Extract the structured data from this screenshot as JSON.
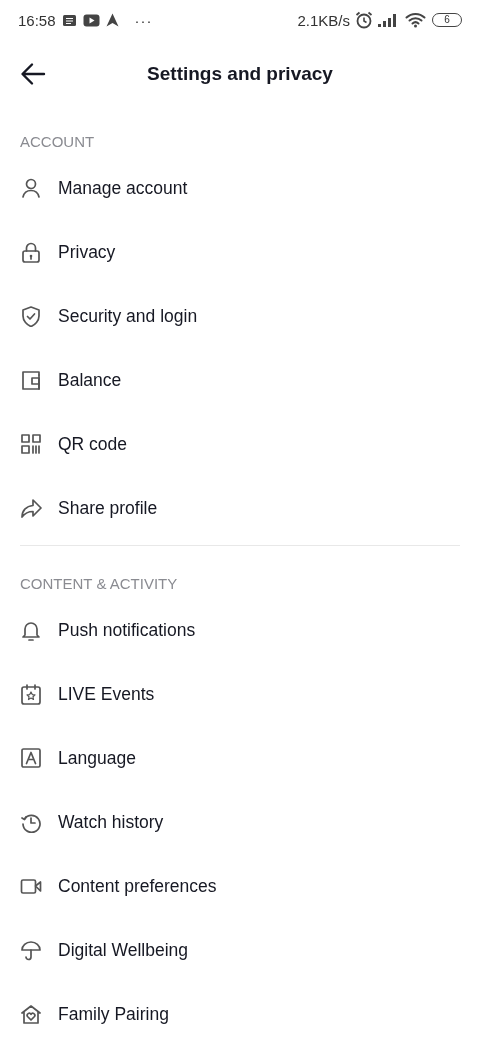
{
  "status_bar": {
    "time": "16:58",
    "more": "···",
    "speed": "2.1KB/s",
    "battery": "6"
  },
  "header": {
    "title": "Settings and privacy"
  },
  "sections": [
    {
      "title": "ACCOUNT",
      "items": [
        {
          "label": "Manage account"
        },
        {
          "label": "Privacy"
        },
        {
          "label": "Security and login"
        },
        {
          "label": "Balance"
        },
        {
          "label": "QR code"
        },
        {
          "label": "Share profile"
        }
      ]
    },
    {
      "title": "CONTENT & ACTIVITY",
      "items": [
        {
          "label": "Push notifications"
        },
        {
          "label": "LIVE Events"
        },
        {
          "label": "Language"
        },
        {
          "label": "Watch history"
        },
        {
          "label": "Content preferences"
        },
        {
          "label": "Digital Wellbeing"
        },
        {
          "label": "Family Pairing"
        }
      ]
    }
  ]
}
